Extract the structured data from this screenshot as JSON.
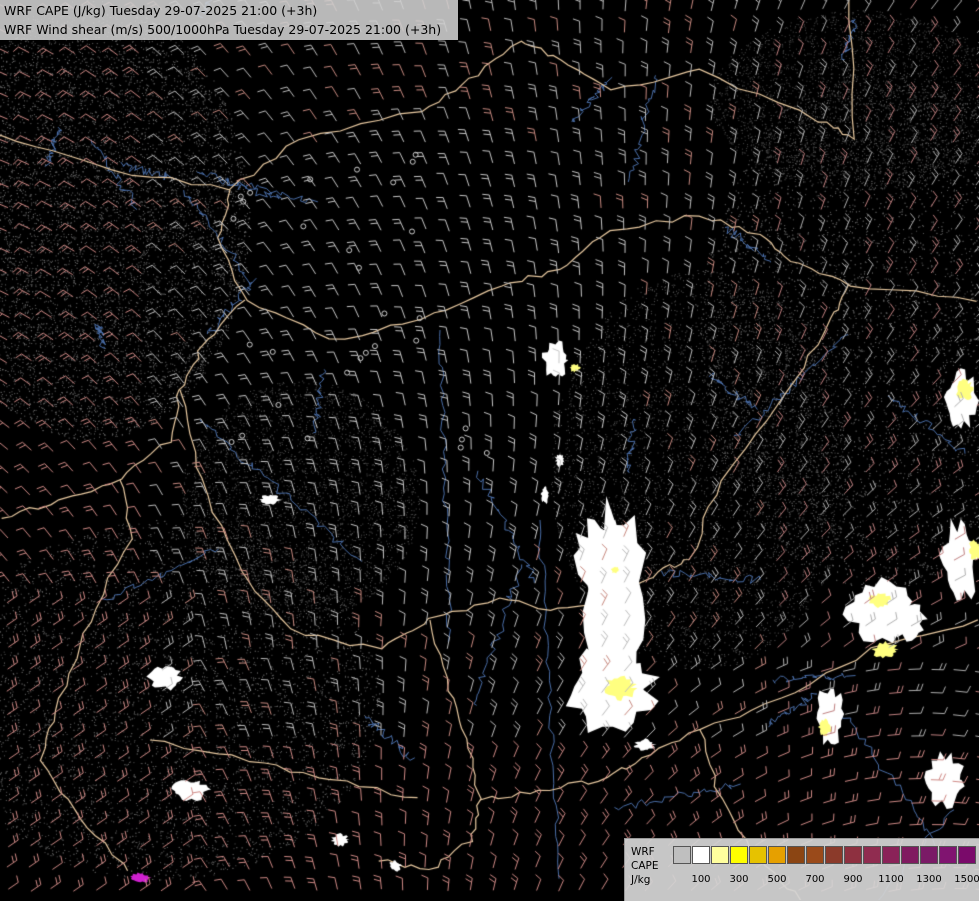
{
  "map": {
    "title_line_1": "WRF CAPE (J/kg) Tuesday 29-07-2025 21:00 (+3h)",
    "title_line_2": "WRF Wind shear (m/s) 500/1000hPa Tuesday 29-07-2025 21:00 (+3h)"
  },
  "legend": {
    "label_line_1": "WRF",
    "label_line_2": "CAPE",
    "label_line_3": "J/kg",
    "colors": [
      "#bfbfbf",
      "#ffffff",
      "#ffff9e",
      "#ffff00",
      "#e6c200",
      "#e6a000",
      "#8b4513",
      "#9a4a1a",
      "#8b3a2a",
      "#8e3040",
      "#902c50",
      "#8a2258",
      "#801a60",
      "#7a1a66",
      "#801470",
      "#7a0a6a"
    ],
    "ticks": [
      "100",
      "300",
      "500",
      "700",
      "900",
      "1100",
      "1300",
      "1500"
    ]
  },
  "overlay_colors": {
    "border": "#e8c9a0",
    "river": "#4a6ea8",
    "barb_west": "#d08a86",
    "barb_center": "#d0d0d0",
    "cape_low": "#ffffff",
    "cape_mid": "#ffff80"
  }
}
